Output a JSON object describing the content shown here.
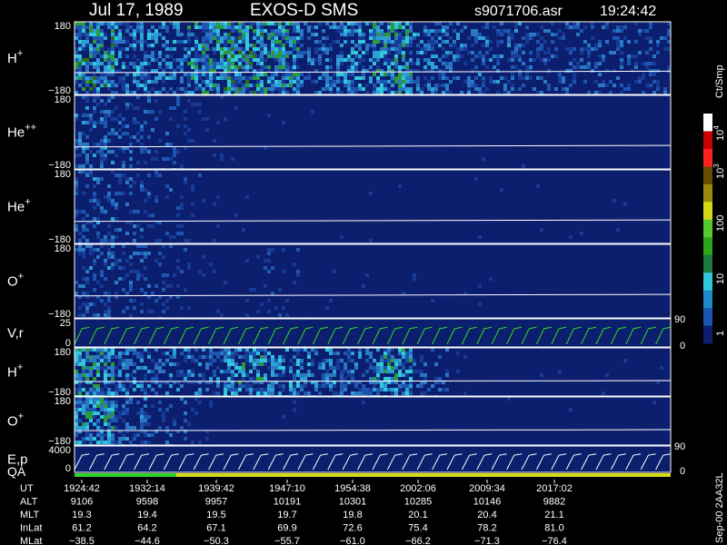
{
  "header": {
    "date": "Jul 17, 1989",
    "instrument": "EXOS-D SMS",
    "file": "s9071706.asr",
    "time": "19:24:42"
  },
  "colorbar": {
    "unit": "Ct/Smp",
    "ticks": [
      "1",
      "10",
      "100",
      "10",
      "10",
      "0",
      "90",
      "0",
      "90",
      "0"
    ],
    "exponents": {
      "1000": "3",
      "10000": "4"
    }
  },
  "colors": {
    "background": "#000000",
    "panel_bg": "#0c1f6e",
    "axis": "#ffffff",
    "green_curve": "#33d61f",
    "qa_bar_good": "#2fd12f",
    "qa_bar_mid": "#d8d81a"
  },
  "chart_data": {
    "type": "heatmap",
    "x_times": [
      "1924:42",
      "1932:14",
      "1939:42",
      "1947:10",
      "1954:38",
      "2002:06",
      "2009:34",
      "2017:02"
    ],
    "colorscale_labels": [
      "1",
      "10",
      "100",
      "10^3",
      "10^4"
    ],
    "panels": [
      {
        "label": "H",
        "superscript": "+",
        "ytop": "180",
        "ybottom": "−180",
        "kind": "pitch",
        "activity": [
          0.9,
          0.7,
          0.6,
          0.8,
          0.95,
          0.85,
          0.5,
          0.7,
          0.85,
          0.6,
          0.5,
          0.45,
          0.4,
          0.4,
          0.4,
          0.4
        ]
      },
      {
        "label": "He",
        "superscript": "++",
        "ytop": "180",
        "ybottom": "−180",
        "kind": "pitch",
        "activity": [
          0.5,
          0.4,
          0.3,
          0.15,
          0.05,
          0.03,
          0.02,
          0.02,
          0.02,
          0.02,
          0.02,
          0.02,
          0.02,
          0.02,
          0.02,
          0.02
        ]
      },
      {
        "label": "He",
        "superscript": "+",
        "ytop": "180",
        "ybottom": "−180",
        "kind": "pitch",
        "activity": [
          0.45,
          0.35,
          0.3,
          0.15,
          0.04,
          0.03,
          0.03,
          0.03,
          0.03,
          0.03,
          0.03,
          0.03,
          0.03,
          0.03,
          0.03,
          0.03
        ]
      },
      {
        "label": "O",
        "superscript": "+",
        "ytop": "180",
        "ybottom": "−180",
        "kind": "pitch",
        "activity": [
          0.45,
          0.35,
          0.25,
          0.12,
          0.05,
          0.2,
          0.04,
          0.03,
          0.03,
          0.03,
          0.03,
          0.03,
          0.03,
          0.03,
          0.03,
          0.03
        ]
      },
      {
        "label": "V,r",
        "superscript": "",
        "ytop": "25",
        "ybottom": "0",
        "kind": "line",
        "right_top": "90",
        "right_bottom": "0"
      },
      {
        "label": "H",
        "superscript": "+",
        "ytop": "180",
        "ybottom": "−180",
        "kind": "pitch",
        "activity": [
          0.85,
          0.6,
          0.5,
          0.5,
          0.75,
          0.7,
          0.6,
          0.5,
          0.8,
          0.4,
          0.05,
          0.03,
          0.03,
          0.03,
          0.03,
          0.03
        ]
      },
      {
        "label": "O",
        "superscript": "+",
        "ytop": "180",
        "ybottom": "−180",
        "kind": "pitch",
        "activity": [
          0.85,
          0.5,
          0.35,
          0.15,
          0.06,
          0.04,
          0.03,
          0.03,
          0.03,
          0.03,
          0.03,
          0.03,
          0.03,
          0.03,
          0.03,
          0.03
        ]
      },
      {
        "label": "E,p",
        "superscript": "",
        "ytop": "4000",
        "ybottom": "0",
        "kind": "line",
        "right_top": "90",
        "right_bottom": "0"
      }
    ],
    "qa_label": "QA"
  },
  "orbit_table": {
    "rows": [
      {
        "label": "UT",
        "values": [
          "1924:42",
          "1932:14",
          "1939:42",
          "1947:10",
          "1954:38",
          "2002:06",
          "2009:34",
          "2017:02"
        ]
      },
      {
        "label": "ALT",
        "values": [
          "9106",
          "9598",
          "9957",
          "10191",
          "10301",
          "10285",
          "10146",
          "9882"
        ]
      },
      {
        "label": "MLT",
        "values": [
          "19.3",
          "19.4",
          "19.5",
          "19.7",
          "19.8",
          "20.1",
          "20.4",
          "21.1"
        ]
      },
      {
        "label": "InLat",
        "values": [
          "61.2",
          "64.2",
          "67.1",
          "69.9",
          "72.6",
          "75.4",
          "78.2",
          "81.0"
        ]
      },
      {
        "label": "MLat",
        "values": [
          "−38.5",
          "−44.6",
          "−50.3",
          "−55.7",
          "−61.0",
          "−66.2",
          "−71.3",
          "−76.4"
        ]
      }
    ]
  },
  "footer": {
    "version": "Sep-00 2AA32L"
  }
}
